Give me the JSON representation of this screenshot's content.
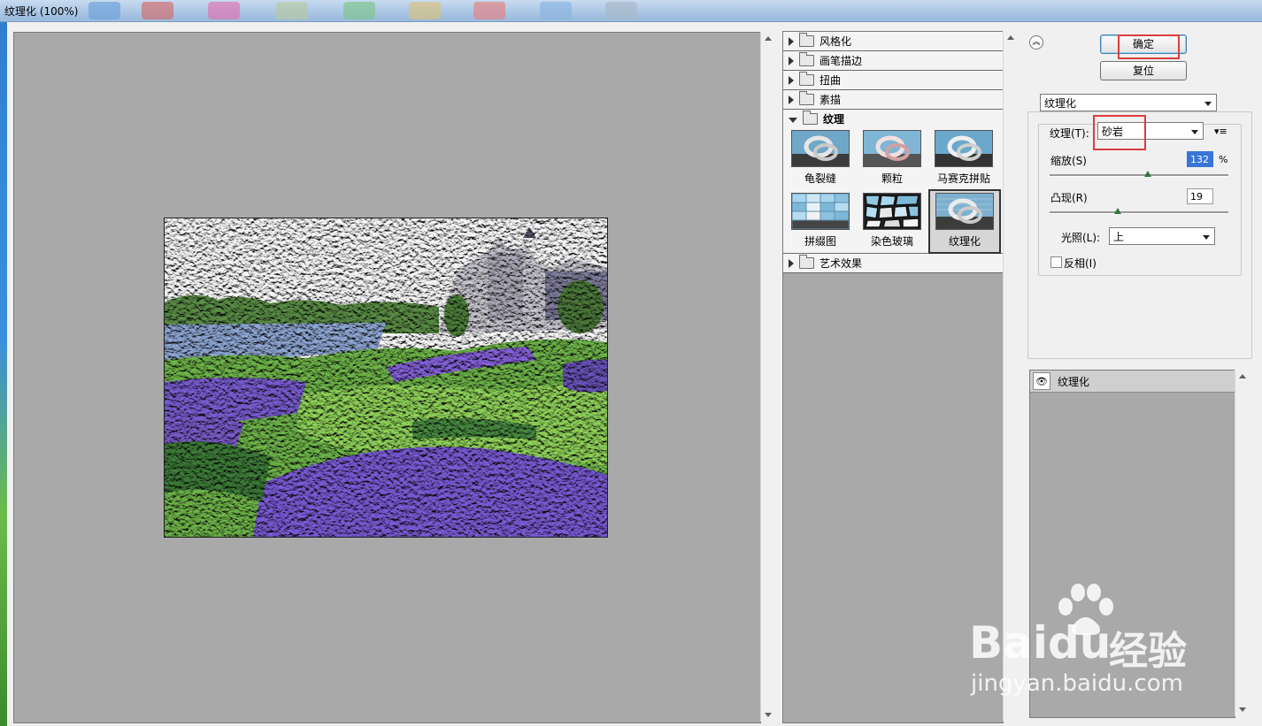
{
  "window": {
    "title": "纹理化 (100%)"
  },
  "actions": {
    "ok_label": "确定",
    "reset_label": "复位"
  },
  "filter_gallery": {
    "categories": [
      {
        "label": "风格化",
        "expanded": false
      },
      {
        "label": "画笔描边",
        "expanded": false
      },
      {
        "label": "扭曲",
        "expanded": false
      },
      {
        "label": "素描",
        "expanded": false
      },
      {
        "label": "纹理",
        "expanded": true
      },
      {
        "label": "艺术效果",
        "expanded": false
      }
    ],
    "texture_filters": [
      {
        "label": "龟裂缝",
        "selected": false
      },
      {
        "label": "颗粒",
        "selected": false
      },
      {
        "label": "马赛克拼贴",
        "selected": false
      },
      {
        "label": "拼缀图",
        "selected": false
      },
      {
        "label": "染色玻璃",
        "selected": false
      },
      {
        "label": "纹理化",
        "selected": true
      }
    ]
  },
  "settings": {
    "filter_select": "纹理化",
    "texture": {
      "label": "纹理(T):",
      "value": "砂岩"
    },
    "scaling": {
      "label": "缩放(S)",
      "value": "132",
      "unit": "%",
      "level_percent": 55
    },
    "relief": {
      "label": "凸现(R)",
      "value": "19",
      "level_percent": 38
    },
    "light": {
      "label": "光照(L):",
      "value": "上"
    },
    "invert": {
      "label": "反相(I)",
      "checked": false
    }
  },
  "effect_layers": [
    {
      "label": "纹理化",
      "visible": true
    }
  ],
  "watermark": {
    "brand_left": "Bai",
    "brand_right": "du",
    "brand_cn": "经验",
    "url": "jingyan.baidu.com"
  },
  "colors": {
    "highlight_box": "#e03b3b",
    "preview_bg": "#a9a9a9"
  }
}
